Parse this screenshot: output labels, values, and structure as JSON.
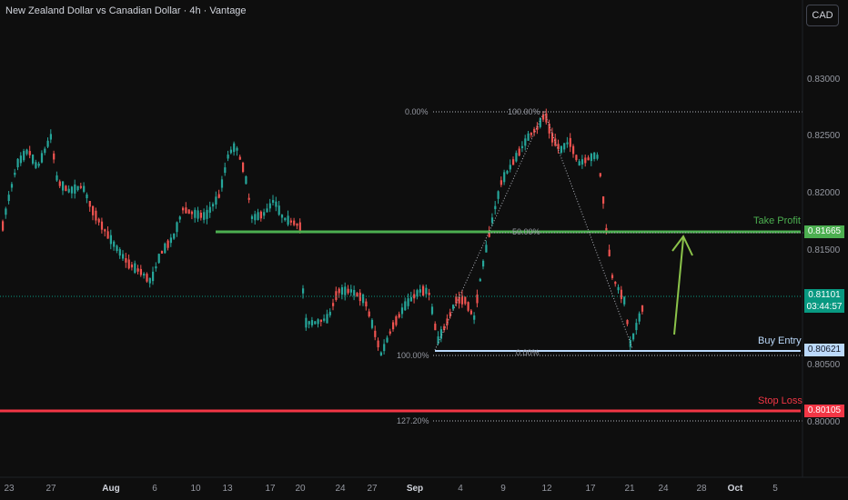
{
  "header": {
    "title": "New Zealand Dollar vs Canadian Dollar · 4h · Vantage",
    "currency_button": "CAD"
  },
  "price_axis": [
    "0.83000",
    "0.82500",
    "0.82000",
    "0.81500",
    "0.80500",
    "0.80000"
  ],
  "time_axis": [
    {
      "label": "23",
      "bold": false
    },
    {
      "label": "27",
      "bold": false
    },
    {
      "label": "Aug",
      "bold": true
    },
    {
      "label": "6",
      "bold": false
    },
    {
      "label": "10",
      "bold": false
    },
    {
      "label": "13",
      "bold": false
    },
    {
      "label": "17",
      "bold": false
    },
    {
      "label": "20",
      "bold": false
    },
    {
      "label": "24",
      "bold": false
    },
    {
      "label": "27",
      "bold": false
    },
    {
      "label": "Sep",
      "bold": true
    },
    {
      "label": "4",
      "bold": false
    },
    {
      "label": "9",
      "bold": false
    },
    {
      "label": "12",
      "bold": false
    },
    {
      "label": "17",
      "bold": false
    },
    {
      "label": "21",
      "bold": false
    },
    {
      "label": "24",
      "bold": false
    },
    {
      "label": "28",
      "bold": false
    },
    {
      "label": "Oct",
      "bold": true
    },
    {
      "label": "5",
      "bold": false
    }
  ],
  "levels": {
    "take_profit": {
      "label": "Take Profit",
      "price": "0.81665",
      "color": "#4caf50"
    },
    "buy_entry": {
      "label": "Buy Entry",
      "price": "0.80621",
      "color": "#bbd9fb"
    },
    "stop_loss": {
      "label": "Stop Loss",
      "price": "0.80105",
      "color": "#f23645"
    },
    "current": {
      "price": "0.81101",
      "countdown": "03:44:57",
      "color": "#089981"
    }
  },
  "fibonacci": {
    "left_labels": [
      "0.00%",
      "100.00%",
      "127.20%"
    ],
    "inner_labels": [
      "100.00%",
      "50.00%",
      "0.00%"
    ]
  },
  "colors": {
    "up": "#26a69a",
    "down": "#ef5350",
    "background": "#0e0e0e"
  }
}
